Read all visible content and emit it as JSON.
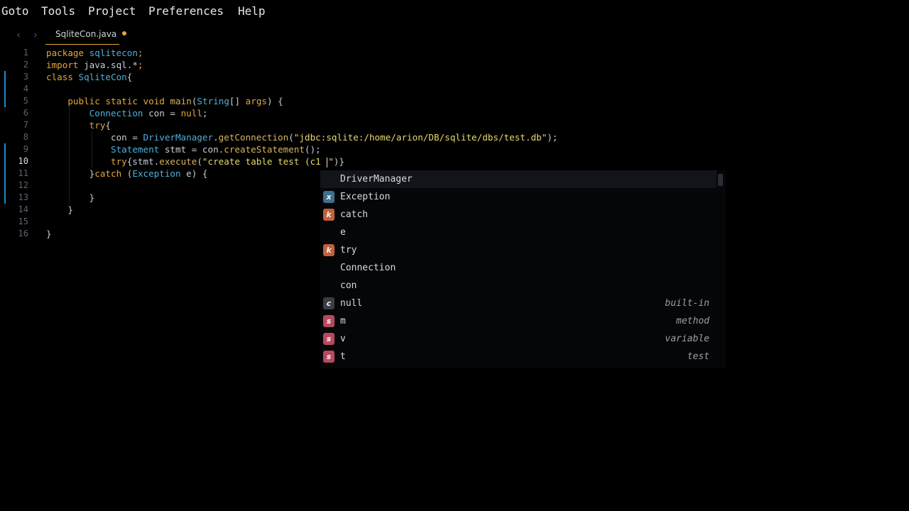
{
  "menu": [
    "Goto",
    "Tools",
    "Project",
    "Preferences",
    "Help"
  ],
  "tab": {
    "title": "SqliteCon.java"
  },
  "editor": {
    "active_line": 10,
    "lines": [
      {
        "num": "1",
        "segs": [
          [
            "kw",
            "package"
          ],
          [
            "pn",
            " "
          ],
          [
            "ty",
            "sqlitecon"
          ],
          [
            "kw",
            ";"
          ]
        ]
      },
      {
        "num": "2",
        "segs": [
          [
            "kw",
            "import"
          ],
          [
            "pn",
            " java.sql.*"
          ],
          [
            "kw",
            ";"
          ]
        ]
      },
      {
        "num": "3",
        "segs": [
          [
            "kw",
            "class"
          ],
          [
            "pn",
            " "
          ],
          [
            "ty",
            "SqliteCon"
          ],
          [
            "pn",
            "{"
          ]
        ]
      },
      {
        "num": "4",
        "segs": []
      },
      {
        "num": "5",
        "segs": [
          [
            "pn",
            "    "
          ],
          [
            "kw",
            "public"
          ],
          [
            "pn",
            " "
          ],
          [
            "kw",
            "static"
          ],
          [
            "pn",
            " "
          ],
          [
            "kw",
            "void"
          ],
          [
            "pn",
            " "
          ],
          [
            "fn",
            "main"
          ],
          [
            "pn",
            "("
          ],
          [
            "ty",
            "String"
          ],
          [
            "pn",
            "[] "
          ],
          [
            "kw",
            "args"
          ],
          [
            "pn",
            ") {"
          ]
        ]
      },
      {
        "num": "6",
        "segs": [
          [
            "pn",
            "        "
          ],
          [
            "ty",
            "Connection"
          ],
          [
            "pn",
            " con = "
          ],
          [
            "kw",
            "null"
          ],
          [
            "pn",
            ";"
          ]
        ]
      },
      {
        "num": "7",
        "segs": [
          [
            "pn",
            "        "
          ],
          [
            "kw",
            "try"
          ],
          [
            "pn",
            "{"
          ]
        ]
      },
      {
        "num": "8",
        "segs": [
          [
            "pn",
            "            con = "
          ],
          [
            "ty",
            "DriverManager"
          ],
          [
            "pn",
            "."
          ],
          [
            "fn",
            "getConnection"
          ],
          [
            "pn",
            "("
          ],
          [
            "str",
            "\"jdbc:sqlite:/home/arion/DB/sqlite/dbs/test.db\""
          ],
          [
            "pn",
            ");"
          ]
        ]
      },
      {
        "num": "9",
        "segs": [
          [
            "pn",
            "            "
          ],
          [
            "ty",
            "Statement"
          ],
          [
            "pn",
            " stmt = con."
          ],
          [
            "fn",
            "createStatement"
          ],
          [
            "pn",
            "();"
          ]
        ]
      },
      {
        "num": "10",
        "segs": [
          [
            "pn",
            "            "
          ],
          [
            "kw",
            "try"
          ],
          [
            "pn",
            "{stmt."
          ],
          [
            "fn",
            "execute"
          ],
          [
            "pn",
            "("
          ],
          [
            "str",
            "\"create table test (c1 "
          ],
          [
            "caret",
            ""
          ],
          [
            "str",
            "\""
          ],
          [
            "pn",
            ")}"
          ]
        ]
      },
      {
        "num": "11",
        "segs": [
          [
            "pn",
            "        }"
          ],
          [
            "kw",
            "catch"
          ],
          [
            "pn",
            " ("
          ],
          [
            "ty",
            "Exception"
          ],
          [
            "pn",
            " e) {"
          ]
        ]
      },
      {
        "num": "12",
        "segs": []
      },
      {
        "num": "13",
        "segs": [
          [
            "pn",
            "        }"
          ]
        ]
      },
      {
        "num": "14",
        "segs": [
          [
            "pn",
            "    }"
          ]
        ]
      },
      {
        "num": "15",
        "segs": []
      },
      {
        "num": "16",
        "segs": [
          [
            "pn",
            "}"
          ]
        ]
      }
    ]
  },
  "autocomplete": {
    "items": [
      {
        "badge": "",
        "badge_color": "",
        "label": "DriverManager",
        "detail": "",
        "selected": true
      },
      {
        "badge": "x",
        "badge_color": "#3f6f8f",
        "label": "Exception",
        "detail": ""
      },
      {
        "badge": "k",
        "badge_color": "#c2603a",
        "label": "catch",
        "detail": ""
      },
      {
        "badge": "",
        "badge_color": "",
        "label": "e",
        "detail": ""
      },
      {
        "badge": "k",
        "badge_color": "#c2603a",
        "label": "try",
        "detail": ""
      },
      {
        "badge": "",
        "badge_color": "",
        "label": "Connection",
        "detail": ""
      },
      {
        "badge": "",
        "badge_color": "",
        "label": "con",
        "detail": ""
      },
      {
        "badge": "c",
        "badge_color": "#3a3d44",
        "label": "null",
        "detail": "built-in"
      },
      {
        "badge": "s",
        "badge_color": "#b8485f",
        "label": "m",
        "detail": "method"
      },
      {
        "badge": "s",
        "badge_color": "#b8485f",
        "label": "v",
        "detail": "variable"
      },
      {
        "badge": "s",
        "badge_color": "#b8485f",
        "label": "t",
        "detail": "test"
      }
    ]
  }
}
